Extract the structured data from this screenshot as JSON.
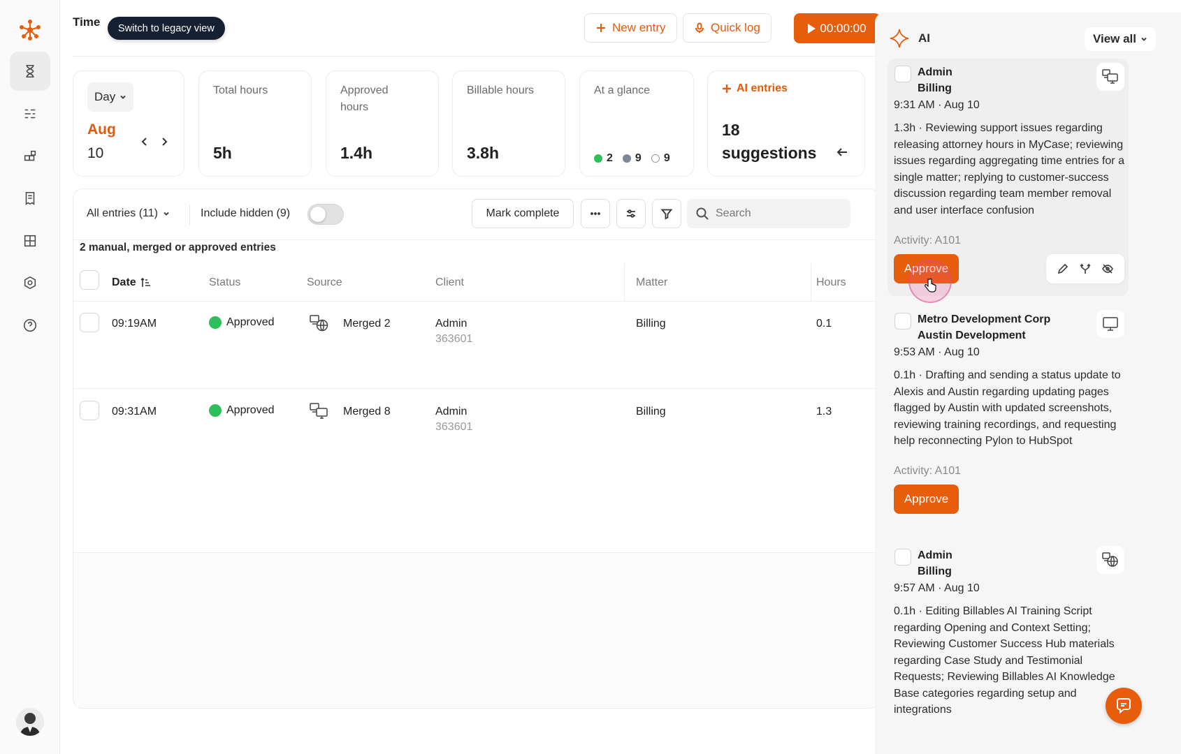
{
  "header": {
    "title": "Time",
    "legacy_view_label": "Switch to legacy view",
    "new_entry_label": "New entry",
    "quick_log_label": "Quick log",
    "timer_label": "00:00:00"
  },
  "sidebar": {
    "items": [
      {
        "name": "timesheet",
        "icon": "hourglass-icon",
        "active": true
      },
      {
        "name": "list-view",
        "icon": "list-icon",
        "active": false
      },
      {
        "name": "integrations",
        "icon": "blocks-icon",
        "active": false
      },
      {
        "name": "reports",
        "icon": "receipt-icon",
        "active": false
      },
      {
        "name": "dashboard",
        "icon": "grid-icon",
        "active": false
      },
      {
        "name": "settings",
        "icon": "hexagon-settings-icon",
        "active": false
      },
      {
        "name": "help",
        "icon": "help-circle-icon",
        "active": false
      }
    ]
  },
  "stats": {
    "day_select": "Day",
    "date_month": "Aug",
    "date_day": "10",
    "total_hours_label": "Total hours",
    "total_hours_value": "5h",
    "approved_hours_label": "Approved hours",
    "approved_hours_value": "1.4h",
    "billable_hours_label": "Billable hours",
    "billable_hours_value": "3.8h",
    "glance_label": "At a glance",
    "glance_green": "2",
    "glance_gray": "9",
    "glance_empty": "9",
    "ai_entries_label": "AI entries",
    "ai_suggestions": "18 suggestions"
  },
  "table": {
    "filter_label": "All entries (11)",
    "include_hidden_label": "Include hidden (9)",
    "include_hidden_on": false,
    "mark_complete_label": "Mark complete",
    "search_placeholder": "Search",
    "caption": "2 manual, merged or approved entries",
    "columns": [
      "Date",
      "Status",
      "Source",
      "Client",
      "Matter",
      "Hours"
    ],
    "rows": [
      {
        "time": "09:19AM",
        "status": "Approved",
        "source_icon": "monitor-globe-icon",
        "source": "Merged 2",
        "client": "Admin",
        "client_id": "363601",
        "matter": "Billing",
        "hours": "0.1"
      },
      {
        "time": "09:31AM",
        "status": "Approved",
        "source_icon": "monitor-desktop-icon",
        "source": "Merged 8",
        "client": "Admin",
        "client_id": "363601",
        "matter": "Billing",
        "hours": "1.3"
      }
    ]
  },
  "ai_panel": {
    "title": "AI",
    "view_all_label": "View all",
    "approve_label": "Approve",
    "suggestions": [
      {
        "client": "Admin",
        "matter": "Billing",
        "time": "9:31 AM · Aug 10",
        "description": "1.3h · Reviewing support issues regarding releasing attorney hours in MyCase; reviewing issues regarding aggregating time entries for a single matter; replying to customer-success discussion regarding team member removal and user interface confusion",
        "activity": "Activity: A101",
        "source_icon": "monitor-desktop-icon"
      },
      {
        "client": "Metro Development Corp",
        "matter": "Austin Development",
        "time": "9:53 AM · Aug 10",
        "description": "0.1h · Drafting and sending a status update to Alexis and Austin regarding updating pages flagged by Austin with updated screenshots, reviewing training recordings, and requesting help reconnecting Pylon to HubSpot",
        "activity": "Activity: A101",
        "source_icon": "desktop-icon"
      },
      {
        "client": "Admin",
        "matter": "Billing",
        "time": "9:57 AM · Aug 10",
        "description": "0.1h · Editing Billables AI Training Script regarding Opening and Context Setting; Reviewing Customer Success Hub materials regarding Case Study and Testimonial Requests; Reviewing Billables AI Knowledge Base categories regarding setup and integrations",
        "activity": "Activity: A101",
        "source_icon": "monitor-globe-icon"
      }
    ]
  },
  "colors": {
    "accent": "#e85d0c",
    "approved": "#2fbf5a",
    "dark_pill": "#152033"
  }
}
